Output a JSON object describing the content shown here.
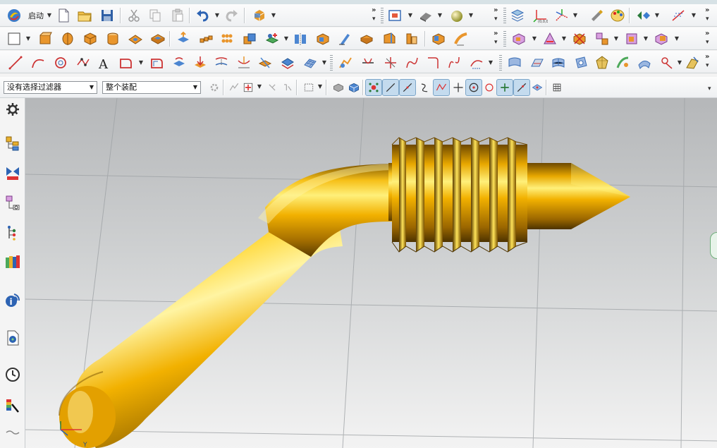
{
  "toolbar": {
    "start_label": "启动",
    "selection_filter": "没有选择过滤器",
    "assembly_scope": "整个装配"
  },
  "colors": {
    "model_gold": "#f2b100",
    "viewport_top": "#b5b7b9",
    "viewport_bottom": "#f3f3f3",
    "active_button": "#c4dbee"
  },
  "viewport": {
    "triad_label": "Y",
    "model": "threaded-bent-probe"
  }
}
